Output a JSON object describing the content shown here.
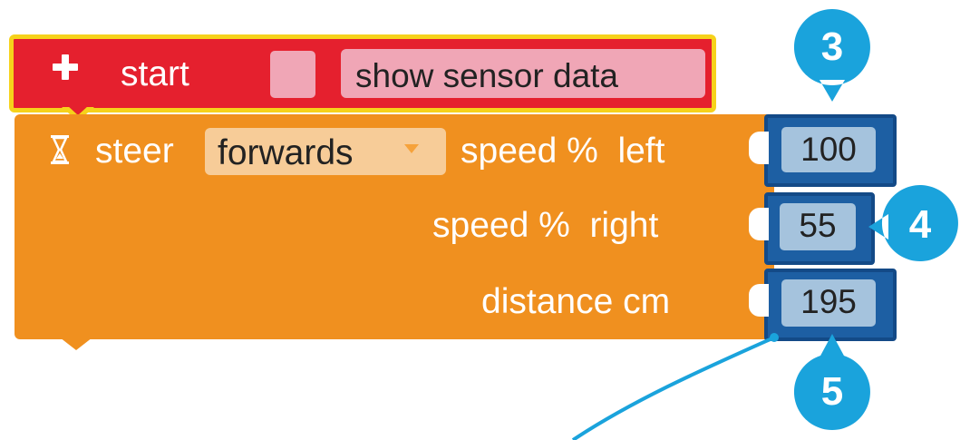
{
  "start_block": {
    "label": "start",
    "button_label": "show sensor data",
    "color": "#e5202e"
  },
  "steer_block": {
    "label": "steer",
    "direction": "forwards",
    "speed_left_label": "speed %  left",
    "speed_right_label": "speed %  right",
    "distance_label": "distance cm",
    "color": "#f0901f"
  },
  "values": {
    "speed_left": "100",
    "speed_right": "55",
    "distance": "195"
  },
  "callouts": {
    "c3": "3",
    "c4": "4",
    "c5": "5",
    "color": "#1aa3dc"
  }
}
